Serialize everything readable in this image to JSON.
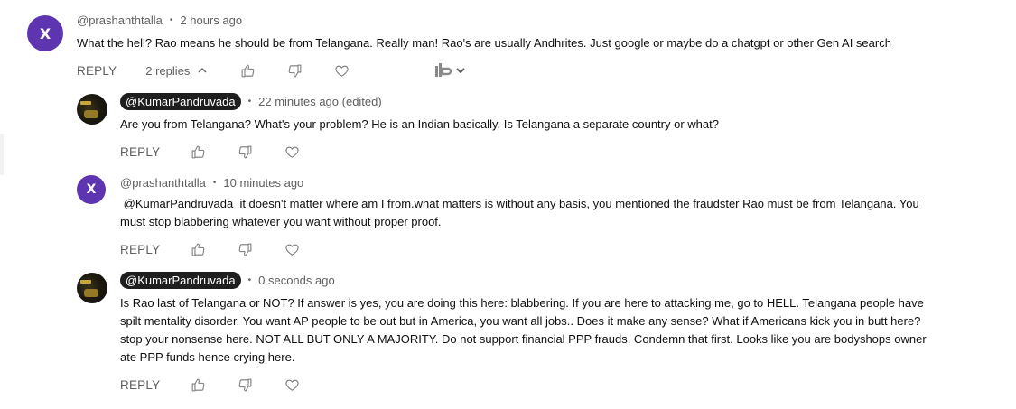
{
  "comments": [
    {
      "author": "@prashanthtalla",
      "time": "2 hours ago",
      "avatar_letter": "X",
      "text": "What the hell? Rao means he should be from Telangana. Really man! Rao's are usually Andhrites. Just google or maybe do a chatgpt or other Gen AI search",
      "reply_label": "REPLY",
      "replies_label": "2 replies",
      "extension_logo": "tb"
    },
    {
      "author": "@KumarPandruvada",
      "time": "22 minutes ago (edited)",
      "text": "Are you from Telangana? What's your problem? He is an Indian basically. Is Telangana a separate country or what?",
      "reply_label": "REPLY"
    },
    {
      "author": "@prashanthtalla",
      "time": "10 minutes ago",
      "avatar_letter": "X",
      "text": " @KumarPandruvada  it doesn't matter where am I from.what matters is without any basis, you mentioned the fraudster Rao must be from Telangana. You must stop blabbering whatever you want without proper proof.",
      "reply_label": "REPLY"
    },
    {
      "author": "@KumarPandruvada",
      "time": "0 seconds ago",
      "text": "Is Rao last of Telangana or NOT? If answer is yes, you are doing this here: blabbering. If you are here to attacking me, go to HELL. Telangana people have spilt mentality disorder. You want AP people to be out but in America, you want all jobs.. Does it make any sense? What if Americans kick you in butt here? stop your nonsense here. NOT ALL BUT ONLY A MAJORITY. Do not support financial PPP frauds. Condemn that first. Looks like you are bodyshops owner ate PPP funds hence crying here.",
      "reply_label": "REPLY"
    }
  ],
  "separator": "•",
  "colors": {
    "avatar_purple": "#5e35b1",
    "meta_gray": "#606060",
    "chip_bg": "#1f1f1f",
    "text": "#0f0f0f"
  },
  "icons": [
    "thumb-up-icon",
    "thumb-down-icon",
    "heart-icon",
    "chevron-up-icon",
    "tb-extension-icon",
    "chevron-down-icon"
  ]
}
